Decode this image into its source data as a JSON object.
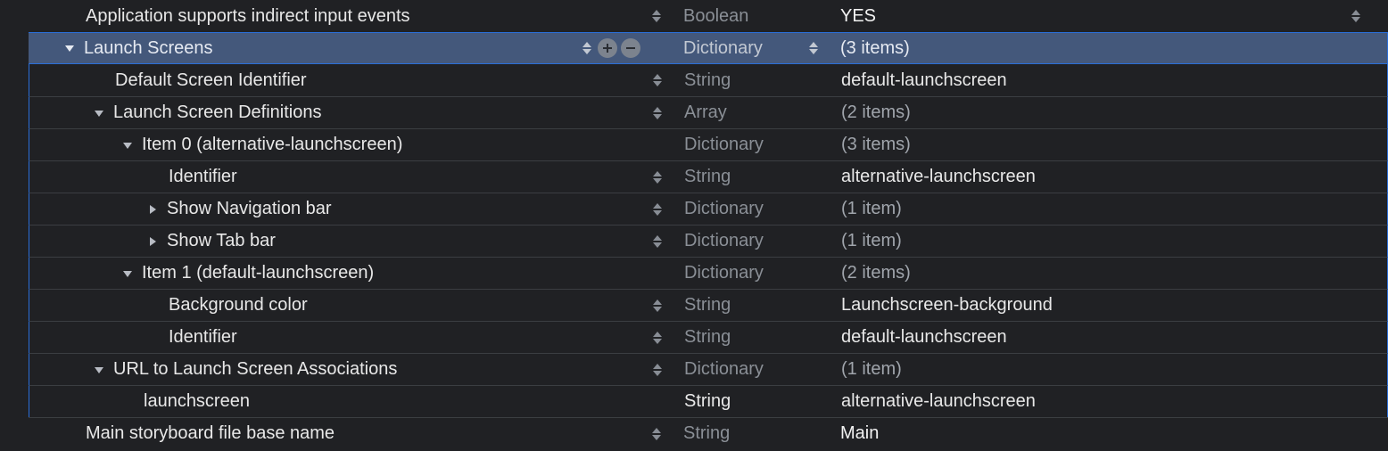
{
  "rows": [
    {
      "key": "Application supports indirect input events",
      "type": "Boolean",
      "value": "YES",
      "indent": 0,
      "triangle": null,
      "selected": false,
      "keyStepper": true,
      "typeStepper": false,
      "valStepper": true,
      "valDim": false,
      "valStrong": true,
      "plusMinus": false,
      "inBlock": false
    },
    {
      "key": "Launch Screens",
      "type": "Dictionary",
      "value": "(3 items)",
      "indent": 0,
      "triangle": "down",
      "selected": true,
      "keyStepper": true,
      "typeStepper": true,
      "valStepper": false,
      "valDim": true,
      "valStrong": false,
      "plusMinus": true,
      "inBlock": true
    },
    {
      "key": "Default Screen Identifier",
      "type": "String",
      "value": "default-launchscreen",
      "indent": 1,
      "triangle": null,
      "selected": false,
      "keyStepper": true,
      "typeStepper": false,
      "valStepper": false,
      "valDim": false,
      "valStrong": false,
      "plusMinus": false,
      "inBlock": true
    },
    {
      "key": "Launch Screen Definitions",
      "type": "Array",
      "value": "(2 items)",
      "indent": 1,
      "triangle": "down",
      "selected": false,
      "keyStepper": true,
      "typeStepper": false,
      "valStepper": false,
      "valDim": true,
      "valStrong": false,
      "plusMinus": false,
      "inBlock": true
    },
    {
      "key": "Item 0 (alternative-launchscreen)",
      "type": "Dictionary",
      "value": "(3 items)",
      "indent": 2,
      "triangle": "down",
      "selected": false,
      "keyStepper": false,
      "typeStepper": false,
      "valStepper": false,
      "valDim": true,
      "valStrong": false,
      "plusMinus": false,
      "inBlock": true
    },
    {
      "key": "Identifier",
      "type": "String",
      "value": "alternative-launchscreen",
      "indent": 3,
      "triangle": null,
      "selected": false,
      "keyStepper": true,
      "typeStepper": false,
      "valStepper": false,
      "valDim": false,
      "valStrong": false,
      "plusMinus": false,
      "inBlock": true
    },
    {
      "key": "Show Navigation bar",
      "type": "Dictionary",
      "value": "(1 item)",
      "indent": 3,
      "triangle": "right",
      "selected": false,
      "keyStepper": true,
      "typeStepper": false,
      "valStepper": false,
      "valDim": true,
      "valStrong": false,
      "plusMinus": false,
      "inBlock": true
    },
    {
      "key": "Show Tab bar",
      "type": "Dictionary",
      "value": "(1 item)",
      "indent": 3,
      "triangle": "right",
      "selected": false,
      "keyStepper": true,
      "typeStepper": false,
      "valStepper": false,
      "valDim": true,
      "valStrong": false,
      "plusMinus": false,
      "inBlock": true
    },
    {
      "key": "Item 1 (default-launchscreen)",
      "type": "Dictionary",
      "value": "(2 items)",
      "indent": 2,
      "triangle": "down",
      "selected": false,
      "keyStepper": false,
      "typeStepper": false,
      "valStepper": false,
      "valDim": true,
      "valStrong": false,
      "plusMinus": false,
      "inBlock": true
    },
    {
      "key": "Background color",
      "type": "String",
      "value": "Launchscreen-background",
      "indent": 3,
      "triangle": null,
      "selected": false,
      "keyStepper": true,
      "typeStepper": false,
      "valStepper": false,
      "valDim": false,
      "valStrong": false,
      "plusMinus": false,
      "inBlock": true
    },
    {
      "key": "Identifier",
      "type": "String",
      "value": "default-launchscreen",
      "indent": 3,
      "triangle": null,
      "selected": false,
      "keyStepper": true,
      "typeStepper": false,
      "valStepper": false,
      "valDim": false,
      "valStrong": false,
      "plusMinus": false,
      "inBlock": true
    },
    {
      "key": "URL to Launch Screen Associations",
      "type": "Dictionary",
      "value": "(1 item)",
      "indent": 1,
      "triangle": "down",
      "selected": false,
      "keyStepper": true,
      "typeStepper": false,
      "valStepper": false,
      "valDim": true,
      "valStrong": false,
      "plusMinus": false,
      "inBlock": true
    },
    {
      "key": "launchscreen",
      "type": "String",
      "value": "alternative-launchscreen",
      "indent": 2,
      "triangle": null,
      "selected": false,
      "keyStepper": false,
      "typeStepper": false,
      "valStepper": false,
      "valDim": false,
      "valStrong": false,
      "plusMinus": false,
      "inBlock": true,
      "typeStrong": true
    },
    {
      "key": "Main storyboard file base name",
      "type": "String",
      "value": "Main",
      "indent": 0,
      "triangle": null,
      "selected": false,
      "keyStepper": true,
      "typeStepper": false,
      "valStepper": false,
      "valDim": false,
      "valStrong": true,
      "plusMinus": false,
      "inBlock": false
    }
  ]
}
